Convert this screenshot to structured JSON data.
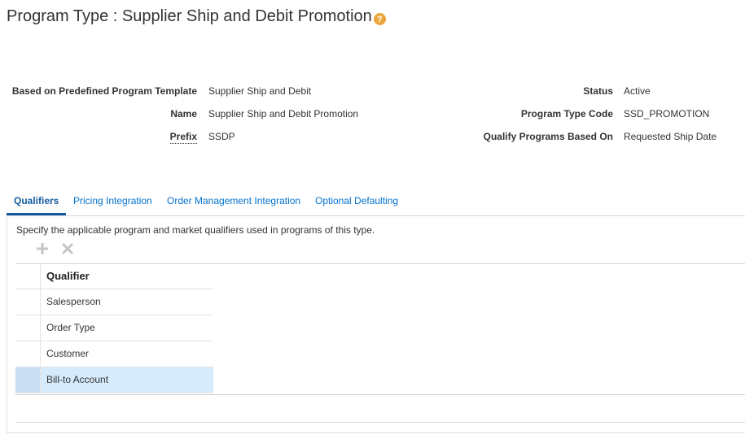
{
  "page": {
    "title": "Program Type : Supplier Ship and Debit Promotion",
    "help_symbol": "?"
  },
  "form": {
    "template_label": "Based on Predefined Program Template",
    "template_value": "Supplier Ship and Debit",
    "name_label": "Name",
    "name_value": "Supplier Ship and Debit Promotion",
    "prefix_label": "Prefix",
    "prefix_value": "SSDP",
    "status_label": "Status",
    "status_value": "Active",
    "code_label": "Program Type Code",
    "code_value": "SSD_PROMOTION",
    "qualify_label": "Qualify Programs Based On",
    "qualify_value": "Requested Ship Date"
  },
  "tabs": [
    {
      "label": "Qualifiers",
      "active": true
    },
    {
      "label": "Pricing Integration",
      "active": false
    },
    {
      "label": "Order Management Integration",
      "active": false
    },
    {
      "label": "Optional Defaulting",
      "active": false
    }
  ],
  "qualifiers": {
    "instructions": "Specify the applicable program and market qualifiers used in programs of this type.",
    "column_header": "Qualifier",
    "rows": [
      "Salesperson",
      "Order Type",
      "Customer",
      "Bill-to Account"
    ],
    "selected_row": "Bill-to Account"
  },
  "colors": {
    "link": "#0572ce",
    "active_tab": "#145c9e",
    "help_icon": "#eaa63c",
    "selected_row": "#d6ebfb"
  },
  "icons": {
    "add": "plus-icon",
    "delete": "x-icon",
    "help": "help-icon"
  }
}
